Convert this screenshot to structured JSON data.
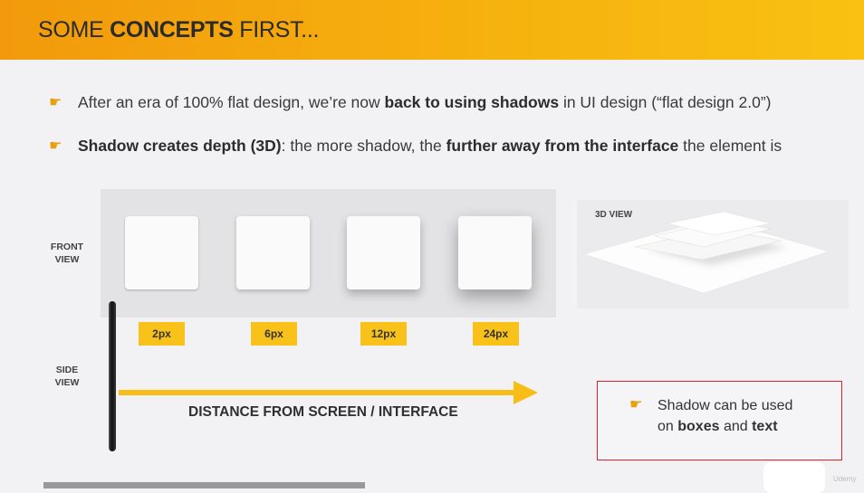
{
  "header": {
    "title_prefix": "SOME ",
    "title_bold": "CONCEPTS",
    "title_suffix": " FIRST..."
  },
  "bullets": [
    {
      "icon": "pointing-hand-icon",
      "t1": "After an era of 100% flat design, we’re now ",
      "b1": "back to using shadows",
      "t2": " in UI design (“flat design 2.0”)",
      "b2": "",
      "t3": ""
    },
    {
      "icon": "pointing-hand-icon",
      "t1": "",
      "b1": "Shadow creates depth (3D)",
      "t2": ": the more shadow, the ",
      "b2": "further away from the interface",
      "t3": " the element is"
    }
  ],
  "diagram": {
    "front_view_line1": "FRONT",
    "front_view_line2": "VIEW",
    "side_view_line1": "SIDE",
    "side_view_line2": "VIEW",
    "shadow_tags": [
      "2px",
      "6px",
      "12px",
      "24px"
    ],
    "arrow_caption": "DISTANCE FROM SCREEN / INTERFACE",
    "view3d_label": "3D VIEW"
  },
  "note": {
    "icon": "pointing-hand-icon",
    "line1": "Shadow can be used",
    "line2_prefix": "on ",
    "line2_bold1": "boxes",
    "line2_mid": " and ",
    "line2_bold2": "text"
  },
  "colors": {
    "accent": "#f8be17",
    "header_start": "#f29a0c",
    "header_end": "#f9c112",
    "note_border": "#d9232d"
  },
  "watermark": "Udemy"
}
